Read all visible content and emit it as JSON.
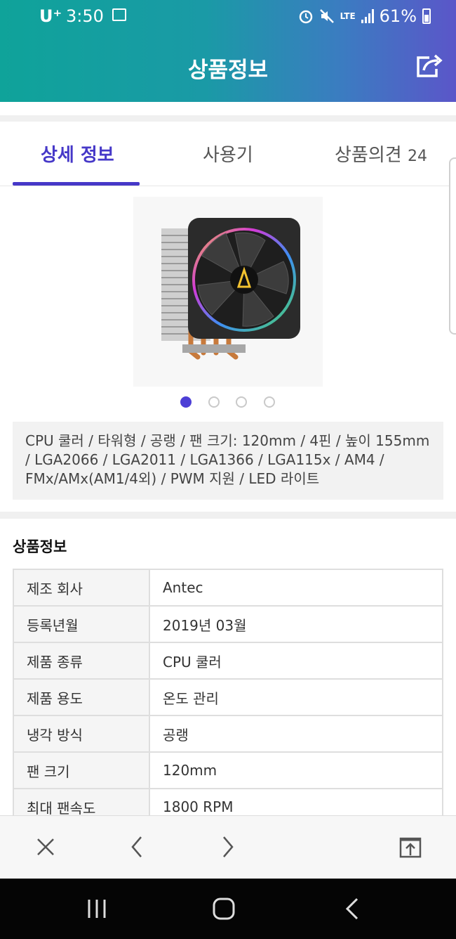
{
  "status_bar": {
    "carrier": "U⁺",
    "time": "3:50",
    "network": "LTE",
    "battery": "61%"
  },
  "header": {
    "title": "상품정보"
  },
  "tabs": [
    {
      "label": "상세 정보",
      "active": true
    },
    {
      "label": "사용기",
      "active": false
    },
    {
      "label": "상품의견",
      "count": "24",
      "active": false
    }
  ],
  "carousel": {
    "total": 4,
    "active_index": 0
  },
  "summary": "CPU 쿨러 / 타워형 / 공랭 / 팬 크기: 120mm / 4핀 / 높이 155mm / LGA2066 / LGA2011 / LGA1366 / LGA115x / AM4 / FMx/AMx(AM1/4외) / PWM 지원 / LED 라이트",
  "spec": {
    "title": "상품정보",
    "rows": [
      {
        "key": "제조 회사",
        "value": "Antec"
      },
      {
        "key": "등록년월",
        "value": "2019년 03월"
      },
      {
        "key": "제품 종류",
        "value": "CPU 쿨러"
      },
      {
        "key": "제품 용도",
        "value": "온도 관리"
      },
      {
        "key": "냉각 방식",
        "value": "공랭"
      },
      {
        "key": "팬 크기",
        "value": "120mm"
      },
      {
        "key": "최대 팬속도",
        "value": "1800 RPM"
      }
    ]
  },
  "colors": {
    "accent": "#4638c8",
    "header_gradient_start": "#0fa39a",
    "header_gradient_end": "#5b56c9"
  },
  "icons": {
    "share": "share-icon",
    "close": "close-icon",
    "back": "chevron-left-icon",
    "forward": "chevron-right-icon",
    "open_external": "open-external-icon"
  }
}
